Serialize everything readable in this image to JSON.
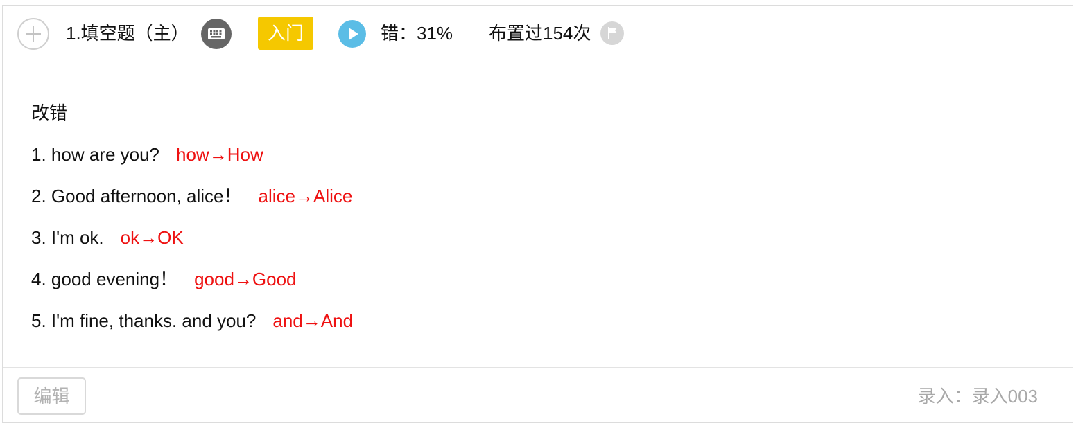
{
  "header": {
    "question_title": "1.填空题（主）",
    "level_badge": "入门",
    "error_rate": "错：31%",
    "assigned_count": "布置过154次",
    "icons": {
      "add": "add-circle-icon",
      "keyboard": "keyboard-icon",
      "play": "play-icon",
      "flag": "flag-icon"
    },
    "colors": {
      "badge": "#f5c800",
      "play": "#5bbde6",
      "keyboard": "#666666"
    }
  },
  "body": {
    "prompt": "改错",
    "items": [
      {
        "text": "1. how are you?",
        "answer": "how→How"
      },
      {
        "text": "2. Good afternoon, alice！",
        "answer": "alice→Alice"
      },
      {
        "text": "3. I'm ok.",
        "answer": "ok→OK"
      },
      {
        "text": "4. good evening！",
        "answer": "good→Good"
      },
      {
        "text": "5. I'm fine, thanks. and you?",
        "answer": "and→And"
      }
    ],
    "answer_color": "#ee1111"
  },
  "footer": {
    "edit_label": "编辑",
    "entered_by": "录入：录入003"
  }
}
